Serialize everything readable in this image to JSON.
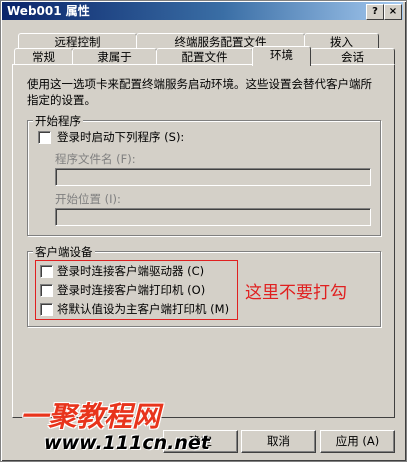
{
  "window": {
    "title": "Web001 属性",
    "help_button": "?",
    "close_button": "×"
  },
  "tabs_row1": [
    {
      "label": "远程控制"
    },
    {
      "label": "终端服务配置文件"
    },
    {
      "label": "拨入"
    }
  ],
  "tabs_row2": [
    {
      "label": "常规"
    },
    {
      "label": "隶属于"
    },
    {
      "label": "配置文件"
    },
    {
      "label": "环境",
      "active": true
    },
    {
      "label": "会话"
    }
  ],
  "description": "使用这一选项卡来配置终端服务启动环境。这些设置会替代客户端所指定的设置。",
  "startup_group": {
    "title": "开始程序",
    "checkbox_label": "登录时启动下列程序 (S):",
    "checked": false,
    "program_label": "程序文件名 (F):",
    "program_value": "",
    "startin_label": "开始位置 (I):",
    "startin_value": ""
  },
  "client_group": {
    "title": "客户端设备",
    "options": [
      {
        "label": "登录时连接客户端驱动器 (C)",
        "checked": false
      },
      {
        "label": "登录时连接客户端打印机 (O)",
        "checked": false
      },
      {
        "label": "将默认值设为主客户端打印机 (M)",
        "checked": false
      }
    ]
  },
  "annotation": "这里不要打勾",
  "buttons": {
    "ok": "确定",
    "cancel": "取消",
    "apply": "应用 (A)"
  },
  "watermark": {
    "name": "一聚教程网",
    "url": "www.111cn.net"
  }
}
